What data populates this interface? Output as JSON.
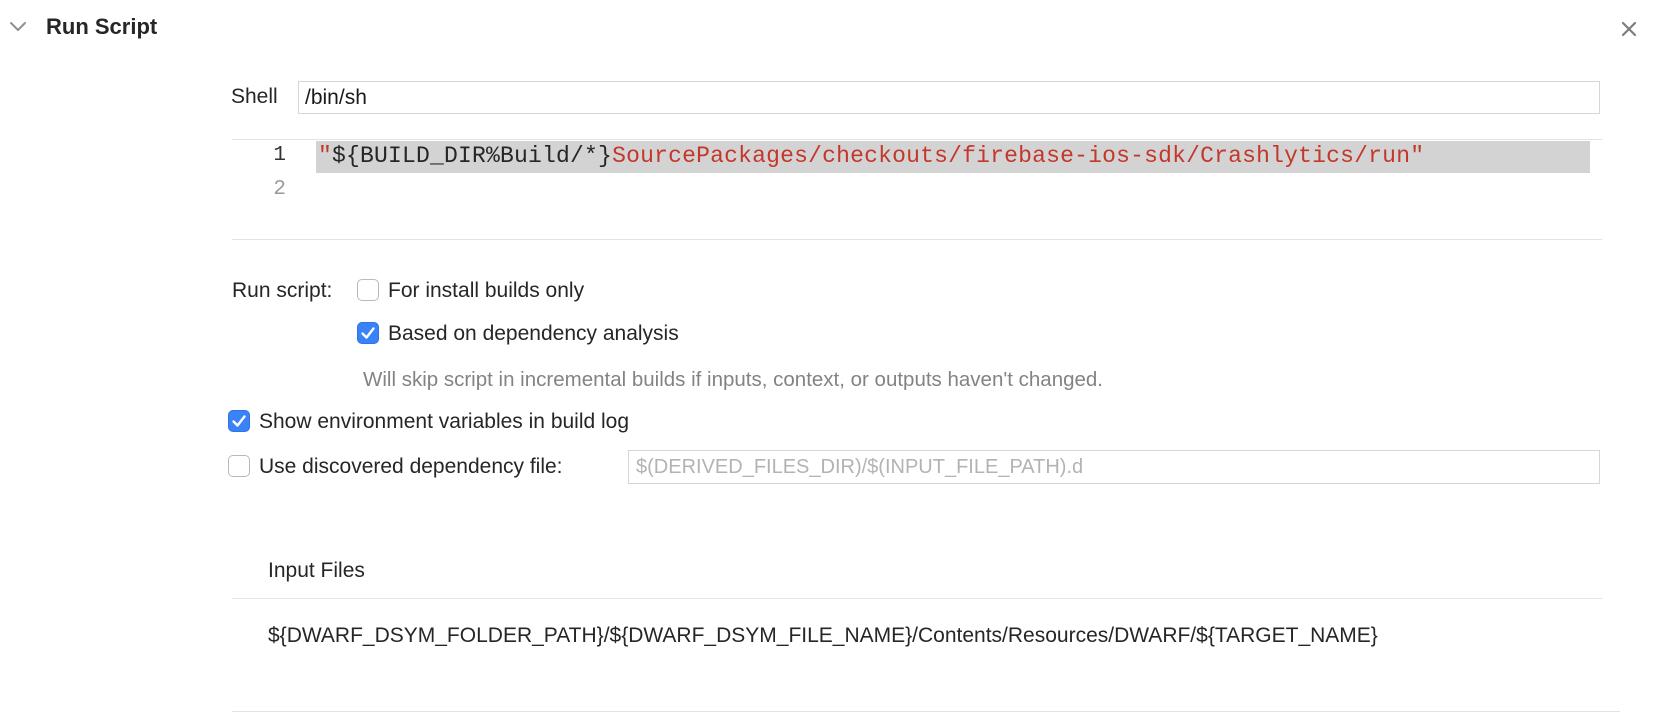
{
  "header": {
    "title": "Run Script",
    "disclosure_icon": "chevron-down-icon",
    "close_icon": "close-icon"
  },
  "shell": {
    "label": "Shell",
    "value": "/bin/sh"
  },
  "script_editor": {
    "line_numbers": [
      "1",
      "2"
    ],
    "line1_tokens": [
      {
        "text": "\"",
        "kind": "string"
      },
      {
        "text": "${BUILD_DIR%Build/*}",
        "kind": "plain"
      },
      {
        "text": "SourcePackages/checkouts/firebase-ios-sdk/Crashlytics/run\"",
        "kind": "string"
      }
    ],
    "highlight_color": "#d3d3d3"
  },
  "run_script": {
    "label": "Run script:",
    "options": [
      {
        "label": "For install builds only",
        "checked": false
      },
      {
        "label": "Based on dependency analysis",
        "checked": true
      }
    ],
    "hint": "Will skip script in incremental builds if inputs, context, or outputs haven't changed."
  },
  "show_env": {
    "label": "Show environment variables in build log",
    "checked": true
  },
  "dependency_file": {
    "label": "Use discovered dependency file:",
    "checked": false,
    "placeholder": "$(DERIVED_FILES_DIR)/$(INPUT_FILE_PATH).d",
    "value": ""
  },
  "input_files": {
    "header": "Input Files",
    "items": [
      "${DWARF_DSYM_FOLDER_PATH}/${DWARF_DSYM_FILE_NAME}/Contents/Resources/DWARF/${TARGET_NAME}"
    ]
  },
  "colors": {
    "accent": "#3a82f7",
    "string_token": "#c4372b",
    "hint_text": "#838383",
    "divider": "#e3e3e3"
  }
}
